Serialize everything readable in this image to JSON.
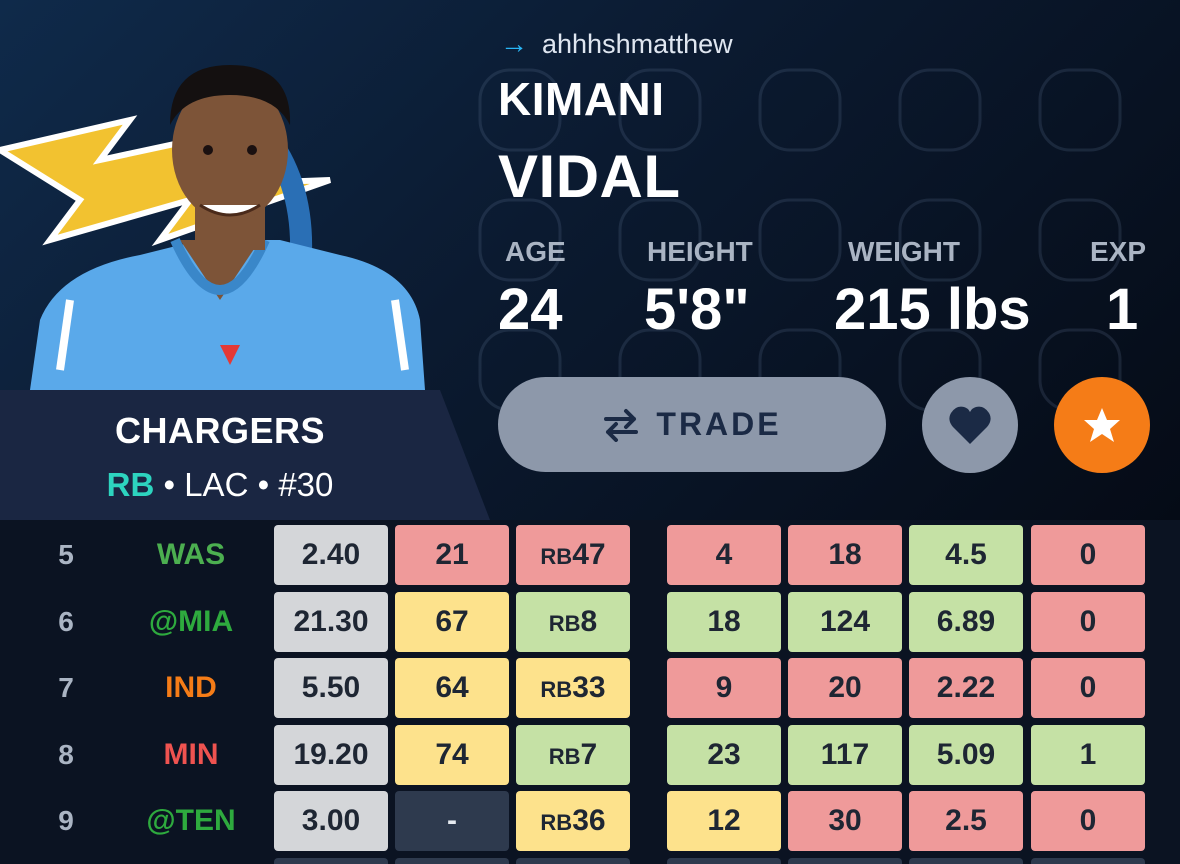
{
  "owner": {
    "username": "ahhhshmatthew"
  },
  "player": {
    "first_name": "KIMANI",
    "last_name": "VIDAL",
    "team_name": "CHARGERS",
    "position": "RB",
    "team_abbr": "LAC",
    "number": "#30"
  },
  "stats": [
    {
      "label": "AGE",
      "value": "24"
    },
    {
      "label": "HEIGHT",
      "value": "5'8\""
    },
    {
      "label": "WEIGHT",
      "value": "215 lbs"
    },
    {
      "label": "EXP",
      "value": "1"
    }
  ],
  "actions": {
    "trade_label": "TRADE",
    "favorite_icon": "heart-icon",
    "star_icon": "star-icon"
  },
  "colors": {
    "accent_orange": "#f57c17",
    "position_teal": "#2dd4bf",
    "good": "#c5e1a5",
    "bad": "#ef9a9a",
    "mid": "#fde28c",
    "neutral": "#d4d6d9"
  },
  "games": [
    {
      "week": "5",
      "opponent": "WAS",
      "opp_color": "#4caf50",
      "cells": [
        {
          "v": "2.40",
          "c": "gray"
        },
        {
          "v": "21",
          "c": "red"
        },
        {
          "p": "RB",
          "v": "47",
          "c": "red"
        },
        {
          "v": "4",
          "c": "red"
        },
        {
          "v": "18",
          "c": "red"
        },
        {
          "v": "4.5",
          "c": "green"
        },
        {
          "v": "0",
          "c": "red"
        }
      ]
    },
    {
      "week": "6",
      "opponent": "@MIA",
      "opp_color": "#2eaa3e",
      "cells": [
        {
          "v": "21.30",
          "c": "gray"
        },
        {
          "v": "67",
          "c": "yellow"
        },
        {
          "p": "RB",
          "v": "8",
          "c": "green"
        },
        {
          "v": "18",
          "c": "green"
        },
        {
          "v": "124",
          "c": "green"
        },
        {
          "v": "6.89",
          "c": "green"
        },
        {
          "v": "0",
          "c": "red"
        }
      ]
    },
    {
      "week": "7",
      "opponent": "IND",
      "opp_color": "#f57c17",
      "cells": [
        {
          "v": "5.50",
          "c": "gray"
        },
        {
          "v": "64",
          "c": "yellow"
        },
        {
          "p": "RB",
          "v": "33",
          "c": "yellow"
        },
        {
          "v": "9",
          "c": "red"
        },
        {
          "v": "20",
          "c": "red"
        },
        {
          "v": "2.22",
          "c": "red"
        },
        {
          "v": "0",
          "c": "red"
        }
      ]
    },
    {
      "week": "8",
      "opponent": "MIN",
      "opp_color": "#ef5350",
      "cells": [
        {
          "v": "19.20",
          "c": "gray"
        },
        {
          "v": "74",
          "c": "yellow"
        },
        {
          "p": "RB",
          "v": "7",
          "c": "green"
        },
        {
          "v": "23",
          "c": "green"
        },
        {
          "v": "117",
          "c": "green"
        },
        {
          "v": "5.09",
          "c": "green"
        },
        {
          "v": "1",
          "c": "green"
        }
      ]
    },
    {
      "week": "9",
      "opponent": "@TEN",
      "opp_color": "#2eaa3e",
      "cells": [
        {
          "v": "3.00",
          "c": "gray"
        },
        {
          "v": "-",
          "c": "dark"
        },
        {
          "p": "RB",
          "v": "36",
          "c": "yellow"
        },
        {
          "v": "12",
          "c": "yellow"
        },
        {
          "v": "30",
          "c": "red"
        },
        {
          "v": "2.5",
          "c": "red"
        },
        {
          "v": "0",
          "c": "red"
        }
      ]
    }
  ]
}
